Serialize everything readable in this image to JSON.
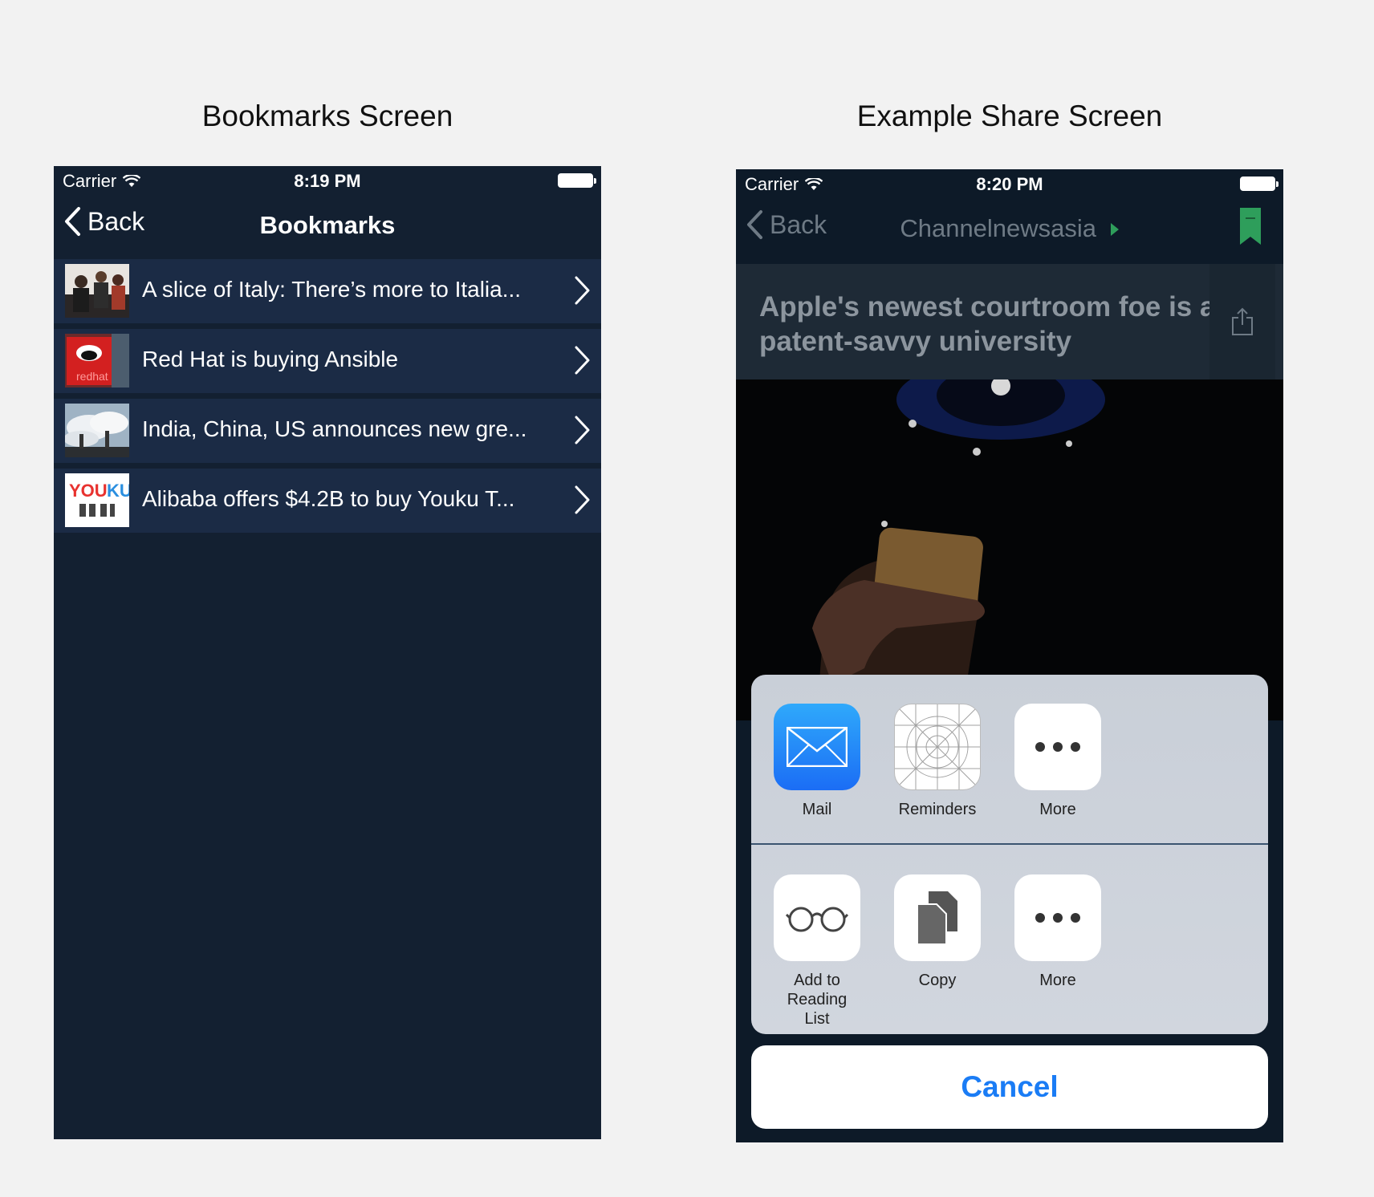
{
  "captions": {
    "left": "Bookmarks Screen",
    "right": "Example Share Screen"
  },
  "bookmarks_screen": {
    "status": {
      "carrier": "Carrier",
      "time": "8:19 PM"
    },
    "nav": {
      "back_label": "Back",
      "title": "Bookmarks"
    },
    "items": [
      {
        "title": "A slice of Italy: There’s more to Italia...",
        "thumb_icon": "people-photo"
      },
      {
        "title": "Red Hat is buying Ansible",
        "thumb_icon": "redhat-logo"
      },
      {
        "title": "India, China, US announces new gre...",
        "thumb_icon": "smokestack-photo"
      },
      {
        "title": "Alibaba offers $4.2B to buy Youku T...",
        "thumb_icon": "youku-logo"
      }
    ]
  },
  "share_screen": {
    "status": {
      "carrier": "Carrier",
      "time": "8:20 PM"
    },
    "nav": {
      "back_label": "Back",
      "title": "Channelnewsasia"
    },
    "headline": "Apple's newest courtroom foe is a patent-savvy university",
    "share_row_1": [
      {
        "label": "Mail",
        "icon": "mail-icon"
      },
      {
        "label": "Reminders",
        "icon": "reminders-icon"
      },
      {
        "label": "More",
        "icon": "more-icon"
      }
    ],
    "share_row_2": [
      {
        "label": "Add to",
        "label2": "Reading List",
        "icon": "reading-list-icon"
      },
      {
        "label": "Copy",
        "icon": "copy-icon"
      },
      {
        "label": "More",
        "icon": "more-icon"
      }
    ],
    "cancel_label": "Cancel"
  },
  "colors": {
    "nav_background": "#132031",
    "row_background": "#1b2b45",
    "bookmark_green": "#2e9e5b",
    "cancel_blue": "#1a7cf5"
  }
}
